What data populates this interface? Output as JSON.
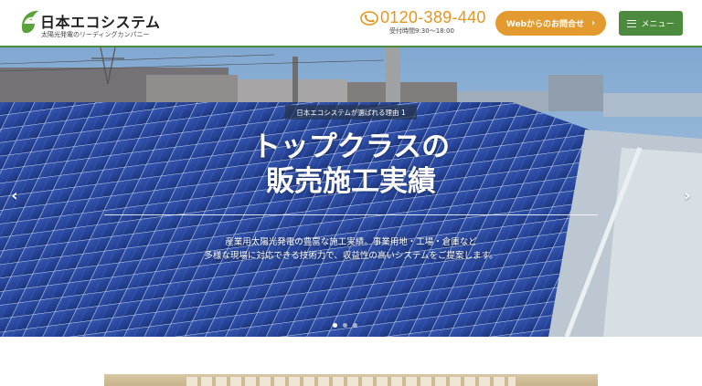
{
  "header": {
    "logo_name": "日本エコシステム",
    "logo_tagline": "太陽光発電のリーディングカンパニー",
    "tel_number": "0120-389-440",
    "tel_hours": "受付時間9:30～18:00",
    "contact_label": "Webからのお問合せ",
    "menu_label": "メニュー"
  },
  "hero": {
    "eyebrow": "日本エコシステムが選ばれる理由 1",
    "headline_line1": "トップクラスの",
    "headline_line2": "販売施工実績",
    "description_line1": "産業用太陽光発電の豊富な施工実績。事業用地・工場・倉庫など",
    "description_line2": "多様な現場に対応できる技術力で、収益性の高いシステムをご提案します。",
    "prev_arrow": "‹",
    "next_arrow": "›",
    "slide_count": 3,
    "active_slide": 1
  },
  "icons": {
    "logo_mark": "leaf-e-logo-icon",
    "phone": "free-dial-phone-icon",
    "contact_chevron": "chevron-right-icon",
    "menu": "hamburger-icon"
  },
  "colors": {
    "brand_green": "#4c8a3e",
    "accent_orange": "#e39a2f",
    "tel_orange": "#e6951f",
    "panel_blue": "#1c3f9a",
    "sky": "#8fb3d6"
  }
}
